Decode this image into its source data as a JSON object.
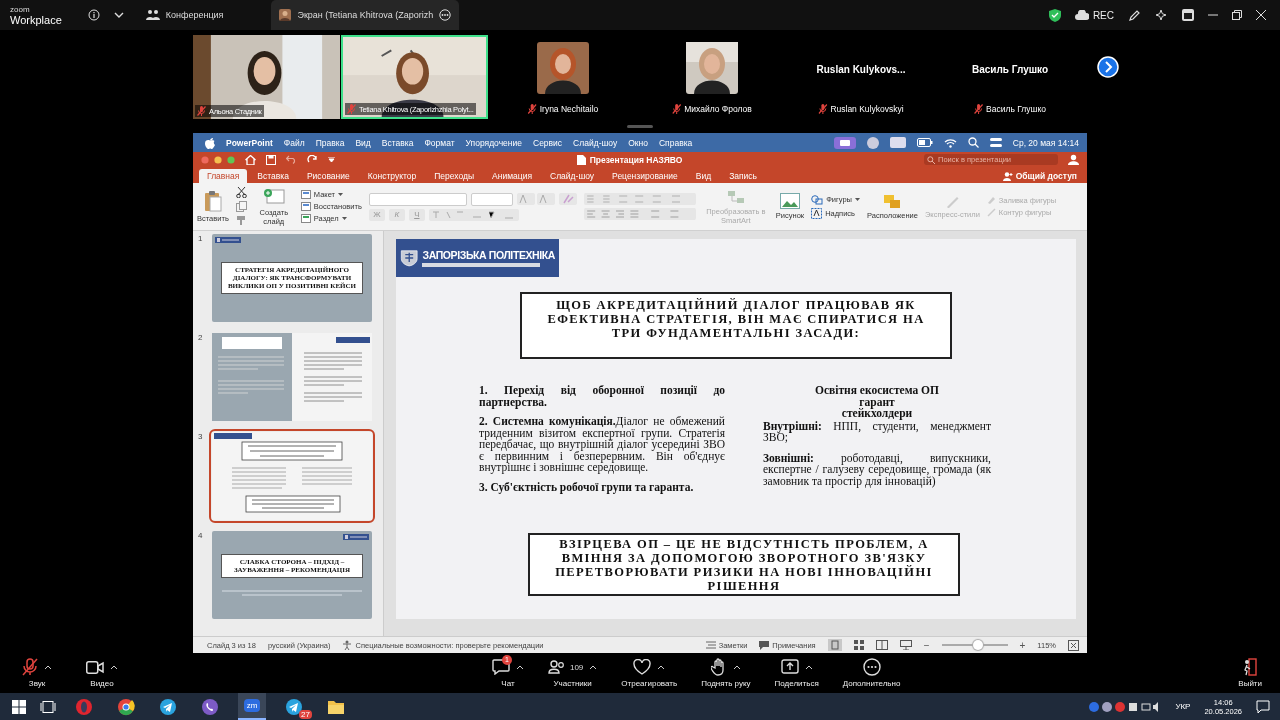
{
  "zoom_top": {
    "logo_top": "zoom",
    "logo_bottom": "Workplace",
    "tabs": [
      {
        "label": "Конференция",
        "selected": false
      },
      {
        "label": "Экран (Tetiana Khitrova (Zaporizh",
        "selected": true
      }
    ],
    "rec": "REC"
  },
  "participants": [
    {
      "kind": "video",
      "name": "Альона Стадник",
      "muted": true,
      "speaking": false
    },
    {
      "kind": "video",
      "name": "Tetiana Khitrova (Zaporizhzhia Polyt...",
      "muted": true,
      "speaking": true
    },
    {
      "name": "Iryna Nechitailo",
      "muted": true,
      "speaking": false
    },
    {
      "name": "Михайло Фролов",
      "muted": true,
      "speaking": false
    },
    {
      "kind": "name",
      "display": "Ruslan  Kulykovs...",
      "name": "Ruslan Kulykovskyi",
      "muted": true,
      "speaking": false
    },
    {
      "kind": "name",
      "display": "Василь Глушко",
      "name": "Василь Глушко",
      "muted": true,
      "speaking": false
    }
  ],
  "mac_menu": {
    "app": "PowerPoint",
    "items": [
      "Файл",
      "Правка",
      "Вид",
      "Вставка",
      "Формат",
      "Упорядочение",
      "Сервис",
      "Слайд-шоу",
      "Окно",
      "Справка"
    ],
    "clock": "Ср, 20 мая  14:14"
  },
  "ppt": {
    "title": "Презентация НАЗЯВО",
    "search_placeholder": "Поиск в презентации",
    "share": "Общий доступ",
    "tabs": [
      {
        "label": "Главная",
        "selected": true
      },
      {
        "label": "Вставка",
        "selected": false
      },
      {
        "label": "Рисование",
        "selected": false
      },
      {
        "label": "Конструктор",
        "selected": false
      },
      {
        "label": "Переходы",
        "selected": false
      },
      {
        "label": "Анимация",
        "selected": false
      },
      {
        "label": "Слайд-шоу",
        "selected": false
      },
      {
        "label": "Рецензирование",
        "selected": false
      },
      {
        "label": "Вид",
        "selected": false
      },
      {
        "label": "Запись",
        "selected": false
      }
    ],
    "ribbon": {
      "paste": "Вставить",
      "new_slide": "Создать слайд",
      "slide_menu": [
        {
          "label": "Макет",
          "dropdown": true
        },
        {
          "label": "Восстановить",
          "dropdown": false
        },
        {
          "label": "Раздел",
          "dropdown": true
        }
      ],
      "format_buttons": [
        "Ж",
        "К",
        "Ч"
      ],
      "smartart": {
        "label": "Преобразовать в SmartArt",
        "disabled": true
      },
      "picture": "Рисунок",
      "shapes": "Фигуры",
      "textbox": "Надпись",
      "arrange": {
        "label": "Расположение",
        "disabled": false
      },
      "quick_styles": {
        "label": "Экспресс-стили",
        "disabled": true
      },
      "shape_fill": {
        "label": "Заливка фигуры",
        "disabled": true
      },
      "shape_outline": {
        "label": "Контур фигуры",
        "disabled": true
      }
    },
    "thumbnails": [
      {
        "number": "1",
        "kind": "title",
        "title": "СТРАТЕГІЯ АКРЕДИТАЦІЙНОГО ДІАЛОГУ: ЯК ТРАНСФОРМУВАТИ ВИКЛИКИ ОП У ПОЗИТИВНІ КЕЙСИ",
        "selected": false
      },
      {
        "number": "2",
        "kind": "split",
        "selected": false
      },
      {
        "number": "3",
        "kind": "content",
        "selected": true
      },
      {
        "number": "4",
        "kind": "title",
        "title": "СЛАБКА СТОРОНА – ПІДХІД – ЗАУВАЖЕННЯ – РЕКОМЕНДАЦІЯ",
        "selected": false
      }
    ],
    "slide": {
      "logo": "ЗАПОРІЗЬКА ПОЛІТЕХНІКА",
      "heading": "ЩОБ АКРЕДИТАЦІЙНИЙ ДІАЛОГ ПРАЦЮВАВ ЯК ЕФЕКТИВНА СТРАТЕГІЯ, ВІН МАЄ СПИРАТИСЯ НА ТРИ ФУНДАМЕНТАЛЬНІ ЗАСАДИ:",
      "points": [
        {
          "lead": "1. Перехід від оборонної позиції до партнерства."
        },
        {
          "lead": "2. Системна комунікація.",
          "text": "Діалог не обмежений триденним візитом експертної групи. Стратегія передбачає, що внутрішній діалог усередині ЗВО є первинним і безперервним. Він об'єднує внутрішнє і зовнішнє середовище."
        },
        {
          "lead": "3. Суб'єктність робочої групи та гаранта."
        }
      ],
      "eco_heading": [
        "Освітня екосистема ОП",
        "гарант",
        "стейкхолдери"
      ],
      "eco_items": [
        {
          "lead": "Внутрішні:",
          "text": "НПП, студенти, менеджмент ЗВО;"
        },
        {
          "lead": "Зовнішні:",
          "text": "роботодавці, випускники, експертне / галузеву середовище, громада (як замовник та простір для інновацій)"
        }
      ],
      "conclusion": "ВЗІРЦЕВА ОП – ЦЕ НЕ ВІДСУТНІСТЬ ПРОБЛЕМ, А ВМІННЯ ЗА ДОПОМОГОЮ ЗВОРОТНОГО ЗВ'ЯЗКУ ПЕРЕТВОРЮВАТИ РИЗИКИ НА НОВІ ІННОВАЦІЙНІ РІШЕННЯ"
    },
    "status": {
      "slide": "Слайд 3 из 18",
      "language": "русский (Украина)",
      "accessibility": "Специальные возможности: проверьте рекомендации",
      "notes": "Заметки",
      "comments": "Примечания",
      "zoom_out": "−",
      "zoom_slider": {
        "level": 0.55
      },
      "zoom_in": "+",
      "zoom": "115%"
    }
  },
  "zoom_bottom": {
    "left": [
      {
        "kind": "mic",
        "label": "Звук"
      },
      {
        "kind": "video",
        "label": "Видео"
      }
    ],
    "center": [
      {
        "kind": "chat",
        "label": "Чат",
        "badge": "1"
      },
      {
        "kind": "people",
        "label": "Участники",
        "count": "109"
      },
      {
        "kind": "heart",
        "label": "Отреагировать"
      },
      {
        "kind": "hand",
        "label": "Поднять руку"
      },
      {
        "kind": "share",
        "label": "Поделиться"
      },
      {
        "kind": "more",
        "label": "Дополнительно"
      }
    ],
    "leave": "Выйти"
  },
  "taskbar": {
    "apps": [
      {
        "kind": "opera",
        "active": false
      },
      {
        "kind": "chrome",
        "active": false
      },
      {
        "kind": "telegram",
        "active": false
      },
      {
        "kind": "viber",
        "active": false
      },
      {
        "kind": "zoom",
        "active": true,
        "text": "zm"
      },
      {
        "kind": "telegram",
        "active": false,
        "badge": "27"
      },
      {
        "kind": "folder",
        "active": false
      }
    ],
    "lang": "УКР",
    "time": "14:06",
    "date": "20.05.2026"
  }
}
